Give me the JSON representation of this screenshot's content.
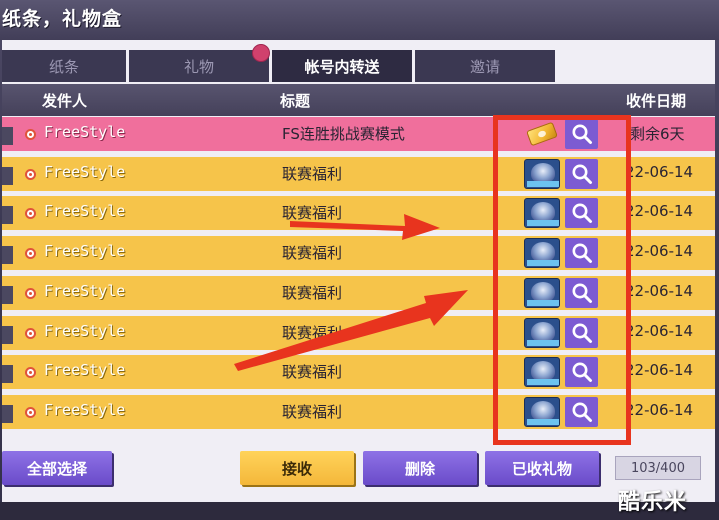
{
  "window": {
    "title": "纸条，礼物盒"
  },
  "tabs": [
    {
      "label": "纸条",
      "active": false
    },
    {
      "label": "礼物",
      "active": false
    },
    {
      "label": "帐号内转送",
      "active": true
    },
    {
      "label": "邀请",
      "active": false
    }
  ],
  "columns": {
    "sender": "发件人",
    "subject": "标题",
    "date": "收件日期"
  },
  "rows": [
    {
      "sender": "FreeStyle",
      "subject": "FS连胜挑战赛模式",
      "item_icon": "ticket-icon",
      "date": "剩余6天",
      "highlighted": true
    },
    {
      "sender": "FreeStyle",
      "subject": "联赛福利",
      "item_icon": "character-card-icon",
      "date": "22-06-14",
      "highlighted": false
    },
    {
      "sender": "FreeStyle",
      "subject": "联赛福利",
      "item_icon": "character-card-icon",
      "date": "22-06-14",
      "highlighted": false
    },
    {
      "sender": "FreeStyle",
      "subject": "联赛福利",
      "item_icon": "character-card-icon",
      "date": "22-06-14",
      "highlighted": false
    },
    {
      "sender": "FreeStyle",
      "subject": "联赛福利",
      "item_icon": "character-card-icon",
      "date": "22-06-14",
      "highlighted": false
    },
    {
      "sender": "FreeStyle",
      "subject": "联赛福利",
      "item_icon": "character-card-icon",
      "date": "22-06-14",
      "highlighted": false
    },
    {
      "sender": "FreeStyle",
      "subject": "联赛福利",
      "item_icon": "character-card-icon",
      "date": "22-06-14",
      "highlighted": false
    },
    {
      "sender": "FreeStyle",
      "subject": "联赛福利",
      "item_icon": "character-card-icon",
      "date": "22-06-14",
      "highlighted": false
    }
  ],
  "actions": {
    "select_all": "全部选择",
    "receive": "接收",
    "delete": "删除",
    "received_gifts": "已收礼物"
  },
  "counter": "103/400",
  "watermark": "酷乐米",
  "colors": {
    "row_yellow": "#f6c44a",
    "row_pink": "#f06f9c",
    "button_purple": "#7c5bd2",
    "annotation_red": "#e8341e"
  }
}
